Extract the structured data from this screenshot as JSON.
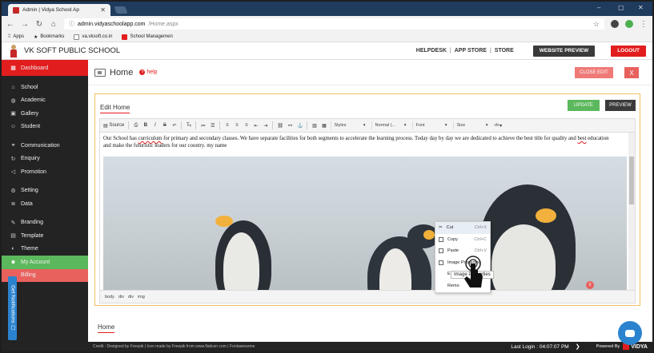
{
  "browser": {
    "tab_title": "Admin | Vidya School Ap",
    "tab_close": "✕",
    "url_host": "admin.vidyaschoolapp.com",
    "url_path": "/Home.aspx",
    "window_min": "–",
    "window_max": "▢",
    "window_close": "✕",
    "bookmarks": [
      "Apps",
      "Bookmarks",
      "va.vksoft.co.in",
      "School Managemen"
    ]
  },
  "header": {
    "school_name": "VK SOFT PUBLIC SCHOOL",
    "helpdesk": "HELPDESK",
    "app_store": "APP STORE",
    "store": "STORE",
    "separator": "|",
    "website_preview": "WEBSITE PREVIEW",
    "logout": "LOGOUT"
  },
  "sidebar": {
    "items": [
      {
        "label": "Dashboard",
        "icon": "dashboard-icon",
        "glyph": "▦"
      },
      {
        "label": "School",
        "icon": "school-icon",
        "glyph": "⌂"
      },
      {
        "label": "Academic",
        "icon": "globe-icon",
        "glyph": "◍"
      },
      {
        "label": "Gallery",
        "icon": "gallery-icon",
        "glyph": "▣"
      },
      {
        "label": "Student",
        "icon": "student-icon",
        "glyph": "☺"
      },
      {
        "label": "Communication",
        "icon": "link-icon",
        "glyph": "⚭"
      },
      {
        "label": "Enquiry",
        "icon": "enquiry-icon",
        "glyph": "↻"
      },
      {
        "label": "Promotion",
        "icon": "megaphone-icon",
        "glyph": "◁"
      },
      {
        "label": "Setting",
        "icon": "gear-icon",
        "glyph": "⚙"
      },
      {
        "label": "Data",
        "icon": "database-icon",
        "glyph": "≣"
      },
      {
        "label": "Branding",
        "icon": "brush-icon",
        "glyph": "✎"
      },
      {
        "label": "Template",
        "icon": "template-icon",
        "glyph": "▤"
      },
      {
        "label": "Theme",
        "icon": "theme-icon",
        "glyph": "◐"
      },
      {
        "label": "My Account",
        "icon": "account-icon",
        "glyph": "☻"
      },
      {
        "label": "Billing",
        "icon": "billing-icon",
        "glyph": ""
      }
    ],
    "notifications": "Get Notifications ☐"
  },
  "main": {
    "title": "Home",
    "help": "help",
    "close_edit": "CLOSE EDIT",
    "close_x": "X",
    "edit_title": "Edit Home",
    "update": "UPDATE",
    "preview": "PREVIEW",
    "footer_tab": "Home"
  },
  "editor": {
    "toolbar": {
      "source": "Source",
      "styles": "Styles",
      "format": "Normal (...",
      "font": "Font",
      "size": "Size"
    },
    "paragraph": {
      "part1": "Our School has ",
      "sp1": "curriculum",
      "part2": " for primary and secondary classes. We have separate facilities for both segments to accelerate the learning process. Today day by day we are dedicated to achieve the best title for quality and ",
      "sp2": "best",
      "part3": " education and make the futuristic leaders for our country. my name"
    },
    "status_path": [
      "body",
      "div",
      "div",
      "img"
    ]
  },
  "context_menu": {
    "items": [
      {
        "label": "Cut",
        "shortcut": "Ctrl+X"
      },
      {
        "label": "Copy",
        "shortcut": "Ctrl+C"
      },
      {
        "label": "Paste",
        "shortcut": "Ctrl+V"
      },
      {
        "label": "Image Properties",
        "shortcut": ""
      },
      {
        "label": "E",
        "shortcut": ""
      },
      {
        "label": "Remo",
        "shortcut": ""
      }
    ],
    "tooltip": "Image Properties"
  },
  "badge_count": "0",
  "footer": {
    "credit": "Credit : Designed by Freepik | Icon made by Freepik from www.flaticon.com | Fontawesome",
    "last_login": "Last Login : 04:07:07 PM",
    "powered_by": "Powered By",
    "brand": "VIDYA"
  },
  "colors": {
    "accent_red": "#e21d1d",
    "success": "#5cb85c",
    "dark": "#232323",
    "info": "#2b83cf"
  }
}
